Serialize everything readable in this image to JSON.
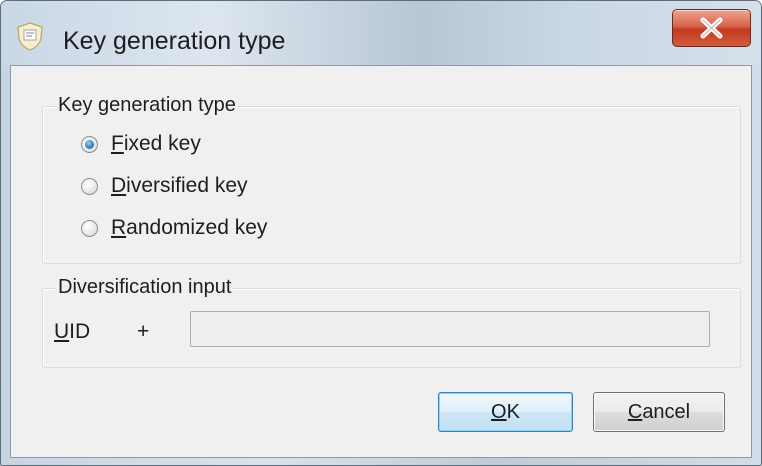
{
  "window": {
    "title": "Key generation type",
    "app_icon": "shield-app-icon",
    "close_icon": "close-x-icon"
  },
  "key_generation_group": {
    "label": "Key generation type",
    "options": [
      {
        "label_accel": "F",
        "label_rest": "ixed key",
        "checked": true
      },
      {
        "label_accel": "D",
        "label_rest": "iversified key",
        "checked": false
      },
      {
        "label_accel": "R",
        "label_rest": "andomized key",
        "checked": false
      }
    ]
  },
  "diversification_group": {
    "label": "Diversification input",
    "uid_accel": "U",
    "uid_rest": "ID",
    "plus": "+",
    "input_value": ""
  },
  "buttons": {
    "ok_accel": "O",
    "ok_rest": "K",
    "cancel_accel": "C",
    "cancel_rest": "ancel"
  },
  "colors": {
    "radio_checked": "#2f83c6",
    "close_button": "#c1391f",
    "ok_border": "#3c7fb1"
  }
}
